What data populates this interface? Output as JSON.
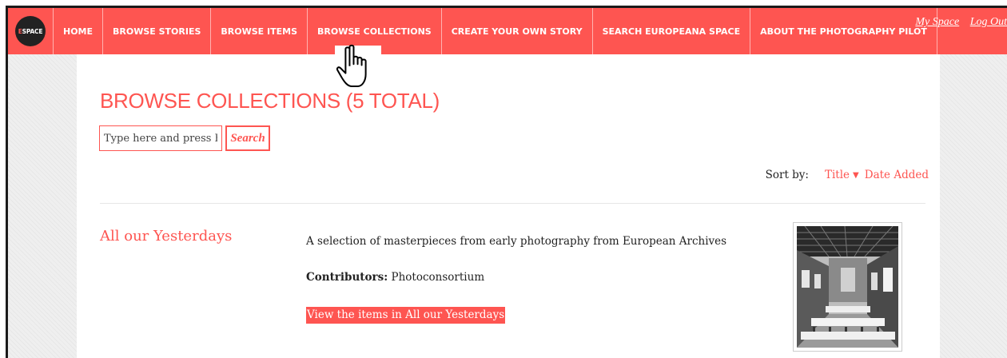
{
  "logo": {
    "text_e": "E",
    "text_rest": "SPACE"
  },
  "nav": {
    "items": [
      "HOME",
      "BROWSE STORIES",
      "BROWSE ITEMS",
      "BROWSE COLLECTIONS",
      "CREATE YOUR OWN STORY",
      "SEARCH EUROPEANA SPACE",
      "ABOUT THE PHOTOGRAPHY PILOT"
    ],
    "my_space": "My Space",
    "log_out": "Log Out"
  },
  "page": {
    "title": "BROWSE COLLECTIONS (5 TOTAL)",
    "search_placeholder": "Type here and press Enter",
    "search_button": "Search",
    "sort_label": "Sort by:",
    "sort_title": "Title",
    "sort_date": "Date Added"
  },
  "collection": {
    "title": "All our Yesterdays",
    "description": "A selection of masterpieces from early photography from European Archives",
    "contributors_label": "Contributors:",
    "contributors_value": "Photoconsortium",
    "view_link": "View the items in All our Yesterdays"
  },
  "colors": {
    "accent": "#fe5551",
    "text": "#222222"
  },
  "icons": {
    "cursor": "pointing-hand-cursor-icon",
    "sort_caret": "caret-down-icon"
  }
}
